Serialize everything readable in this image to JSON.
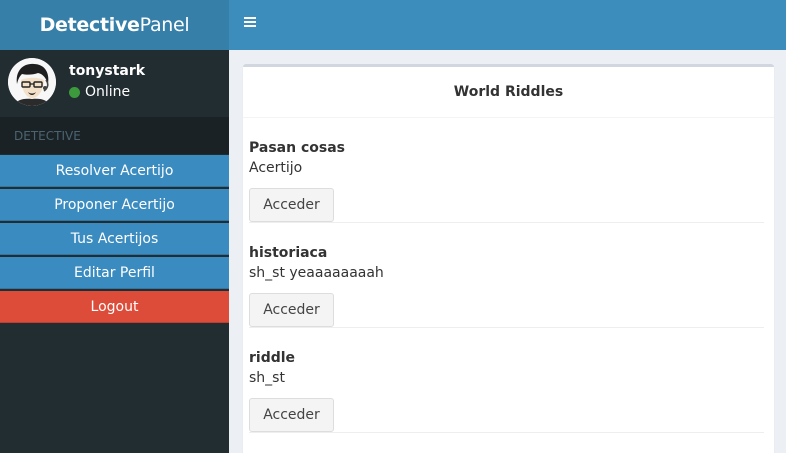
{
  "app": {
    "logo_bold": "Detective",
    "logo_light": "Panel"
  },
  "user": {
    "name": "tonystark",
    "status": "Online",
    "status_color": "#3c9a3c"
  },
  "sidebar": {
    "header": "DETECTIVE",
    "items": [
      {
        "label": "Resolver Acertijo"
      },
      {
        "label": "Proponer Acertijo"
      },
      {
        "label": "Tus Acertijos"
      },
      {
        "label": "Editar Perfil"
      },
      {
        "label": "Logout"
      }
    ]
  },
  "main": {
    "box_title": "World Riddles",
    "riddles": [
      {
        "title": "Pasan cosas",
        "description": "Acertijo",
        "button": "Acceder"
      },
      {
        "title": "historiaca",
        "description": "sh_st yeaaaaaaaah",
        "button": "Acceder"
      },
      {
        "title": "riddle",
        "description": "sh_st",
        "button": "Acceder"
      }
    ]
  },
  "colors": {
    "topbar": "#3c8dbc",
    "logo_bg": "#367fa9",
    "sidebar_bg": "#222d32",
    "menu_item": "#3a8bbf",
    "logout": "#dd4b39"
  }
}
